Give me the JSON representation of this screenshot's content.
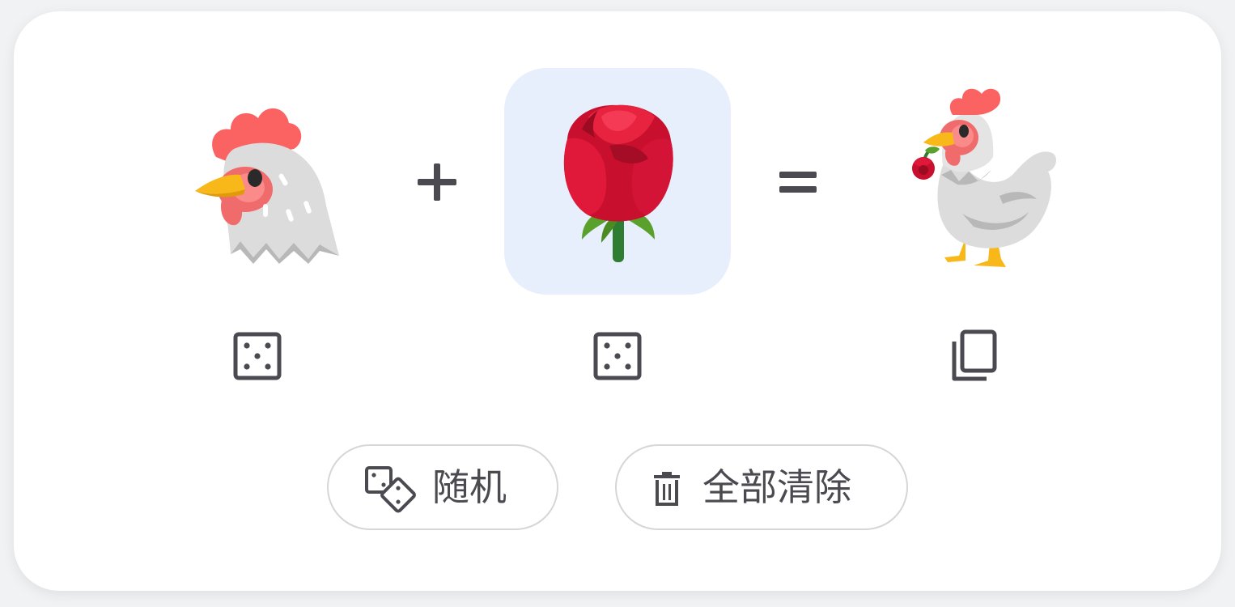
{
  "mixer": {
    "left_emoji": {
      "name": "chicken-face",
      "selected": false
    },
    "operator_plus": "+",
    "right_emoji": {
      "name": "rose",
      "selected": true
    },
    "operator_equals": "=",
    "result_emoji": {
      "name": "chicken-with-rose"
    }
  },
  "controls": {
    "left_random_icon": "dice-icon",
    "right_random_icon": "dice-icon",
    "copy_icon": "copy-icon"
  },
  "actions": {
    "random_label": "随机",
    "random_icon": "dice-pair-icon",
    "clear_label": "全部清除",
    "clear_icon": "trash-icon"
  },
  "colors": {
    "selected_bg": "#e8effc",
    "icon_gray": "#4a4a50",
    "pill_border": "#d6d6d8"
  }
}
